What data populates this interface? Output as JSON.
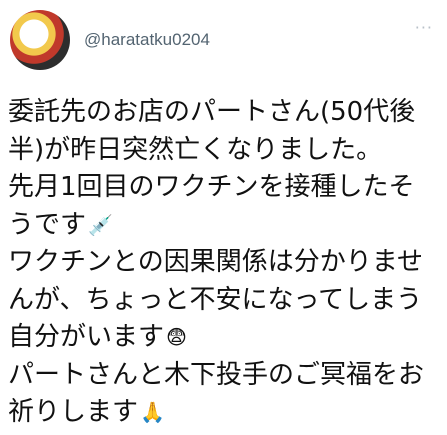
{
  "tweet": {
    "handle": "@haratatku0204",
    "more_label": "···",
    "lines": [
      "委託先のお店のパートさん(50代後",
      "半)が昨日突然亡くなりました。",
      "先月1回目のワクチンを接種したそ",
      "うです",
      "ワクチンとの因果関係は分かりませ",
      "んが、ちょっと不安になってしまう",
      "自分がいます",
      "パートさんと木下投手のご冥福をお",
      "祈りします"
    ],
    "emojis": {
      "syringe": "💉",
      "anxious": "😨",
      "pray": "🙏"
    }
  }
}
